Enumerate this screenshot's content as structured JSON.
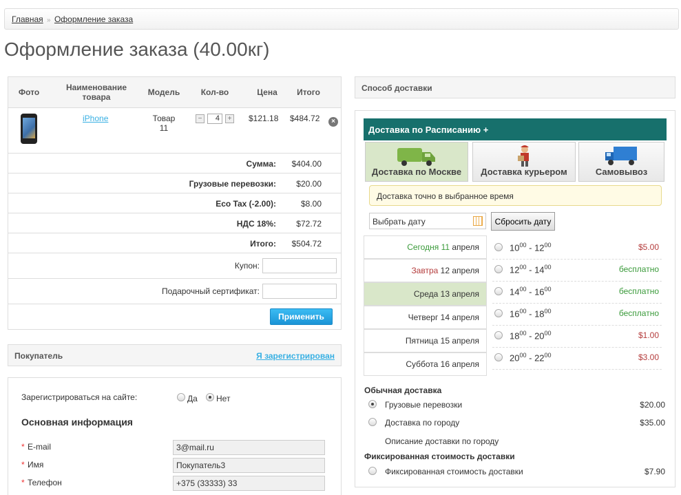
{
  "breadcrumb": {
    "home": "Главная",
    "separator": "»",
    "current": "Оформление заказа"
  },
  "page_title": "Оформление заказа (40.00кг)",
  "cart": {
    "columns": [
      "Фото",
      "Наименование товара",
      "Модель",
      "Кол-во",
      "Цена",
      "Итого"
    ],
    "item": {
      "name": "iPhone",
      "model": "Товар 11",
      "qty": "4",
      "price": "$121.18",
      "total": "$484.72"
    },
    "totals": [
      {
        "label": "Сумма:",
        "value": "$404.00"
      },
      {
        "label": "Грузовые перевозки:",
        "value": "$20.00"
      },
      {
        "label": "Eco Tax (-2.00):",
        "value": "$8.00"
      },
      {
        "label": "НДС 18%:",
        "value": "$72.72"
      },
      {
        "label": "Итого:",
        "value": "$504.72"
      }
    ],
    "coupon_label": "Купон:",
    "voucher_label": "Подарочный сертификат:",
    "apply_label": "Применить"
  },
  "buyer": {
    "title": "Покупатель",
    "registered_link": "Я зарегистрирован",
    "register_label": "Зарегистрироваться на сайте:",
    "yes": "Да",
    "no": "Нет",
    "section_title": "Основная информация",
    "required_mark": "*",
    "email_label": "E-mail",
    "email_value": "3@mail.ru",
    "name_label": "Имя",
    "name_value": "Покупатель3",
    "phone_label": "Телефон",
    "phone_value": "+375 (33333) 33"
  },
  "delivery": {
    "title": "Способ доставки",
    "schedule_title": "Доставка по Расписанию +",
    "tabs": [
      "Доставка по Москве",
      "Доставка курьером",
      "Самовывоз"
    ],
    "note": "Доставка точно в выбранное время",
    "date_placeholder": "Выбрать дату",
    "reset_label": "Сбросить дату",
    "days": [
      {
        "prefix": "Сегодня",
        "num": "11",
        "month": "апреля"
      },
      {
        "prefix": "Завтра",
        "num": "12",
        "month": "апреля"
      },
      {
        "prefix": "Среда",
        "num": "13",
        "month": "апреля"
      },
      {
        "prefix": "Четверг",
        "num": "14",
        "month": "апреля"
      },
      {
        "prefix": "Пятница",
        "num": "15",
        "month": "апреля"
      },
      {
        "prefix": "Суббота",
        "num": "16",
        "month": "апреля"
      }
    ],
    "slots": [
      {
        "from": "10",
        "to": "12",
        "sup": "00",
        "dash": "-",
        "price": "$5.00"
      },
      {
        "from": "12",
        "to": "14",
        "sup": "00",
        "dash": "-",
        "price": "бесплатно"
      },
      {
        "from": "14",
        "to": "16",
        "sup": "00",
        "dash": "-",
        "price": "бесплатно"
      },
      {
        "from": "16",
        "to": "18",
        "sup": "00",
        "dash": "-",
        "price": "бесплатно"
      },
      {
        "from": "18",
        "to": "20",
        "sup": "00",
        "dash": "-",
        "price": "$1.00"
      },
      {
        "from": "20",
        "to": "22",
        "sup": "00",
        "dash": "-",
        "price": "$3.00"
      }
    ],
    "regular_title": "Обычная доставка",
    "regular_options": [
      {
        "label": "Грузовые перевозки",
        "price": "$20.00"
      },
      {
        "label": "Доставка по городу",
        "price": "$35.00"
      }
    ],
    "city_desc": "Описание доставки по городу",
    "fixed_title": "Фиксированная стоимость доставки",
    "fixed_option": {
      "label": "Фиксированная стоимость доставки",
      "price": "$7.90"
    }
  },
  "colors": {
    "accent": "#17706c",
    "link": "#38b0e3",
    "button": "#1b94d6",
    "selected_bg": "#d9e7c9"
  }
}
